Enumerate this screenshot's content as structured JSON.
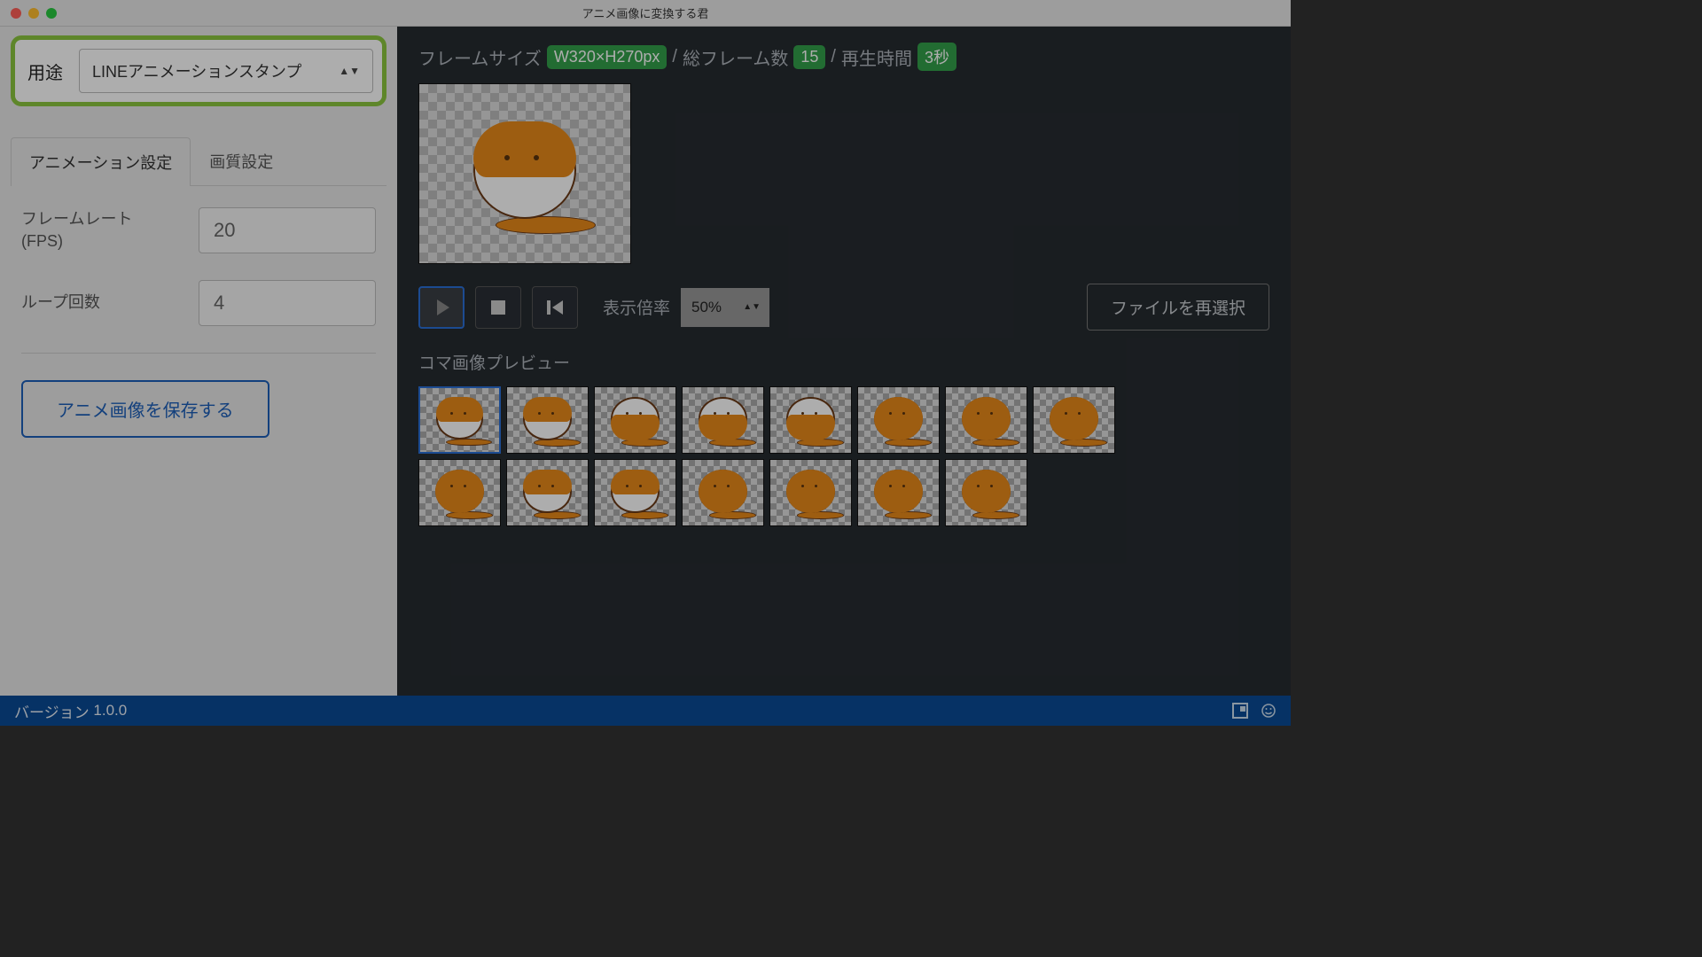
{
  "window": {
    "title": "アニメ画像に変換する君"
  },
  "sidebar": {
    "purpose_label": "用途",
    "purpose_value": "LINEアニメーションスタンプ",
    "tabs": {
      "anim": "アニメーション設定",
      "quality": "画質設定"
    },
    "fps_label": "フレームレート\n(FPS)",
    "fps_value": "20",
    "loop_label": "ループ回数",
    "loop_value": "4",
    "save_button": "アニメ画像を保存する"
  },
  "main": {
    "frame_size_label": "フレームサイズ",
    "frame_size_value": "W320×H270px",
    "total_frames_label": "総フレーム数",
    "total_frames_value": "15",
    "duration_label": "再生時間",
    "duration_value": "3秒",
    "sep": " / ",
    "zoom_label": "表示倍率",
    "zoom_value": "50%",
    "reselect": "ファイルを再選択",
    "frames_heading": "コマ画像プレビュー",
    "frame_count": 15
  },
  "status": {
    "version_label": "バージョン",
    "version_value": "1.0.0"
  }
}
